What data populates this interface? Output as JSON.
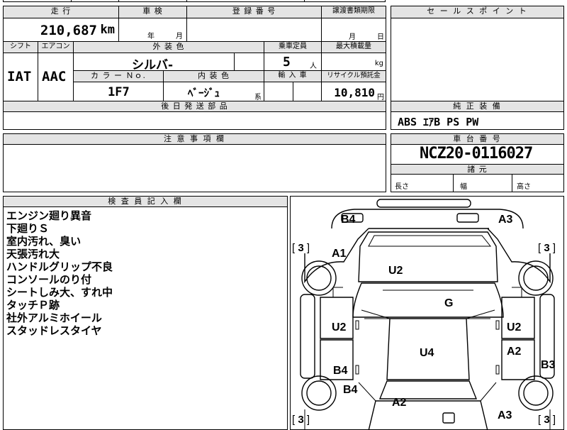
{
  "top": {
    "mileage_label": "走 行",
    "mileage_value": "210,687",
    "mileage_unit": "km",
    "inspection_label": "車 検",
    "year_unit": "年",
    "month_unit": "月",
    "reg_label": "登 録 番 号",
    "transfer_label": "譲渡書類期限",
    "transfer_month": "月",
    "transfer_day": "日"
  },
  "row2": {
    "shift_label": "シフト",
    "ac_label": "エアコン",
    "color_label": "外 装 色",
    "capacity_label": "乗車定員",
    "load_label": "最大積載量",
    "shift_value": "IAT",
    "ac_value": "AAC",
    "color_value": "シルバ-",
    "capacity_value": "5",
    "capacity_unit": "人",
    "load_unit": "kg",
    "color_no_label": "カ ラ ー Ｎｏ.",
    "interior_label": "内 装 色",
    "import_label": "輸 入 車",
    "recycle_label": "リサイクル預託金",
    "color_no_value": "1F7",
    "interior_value": "ﾍﾞｰｼﾞｭ",
    "interior_unit": "系",
    "recycle_value": "10,810",
    "recycle_unit": "円",
    "later_parts_label": "後 日 発 送 部 品"
  },
  "sales": {
    "label": "セ ー ル ス ポ イ ン ト"
  },
  "equipment": {
    "label": "純 正 装 備",
    "value": "ABS ｴｱB PS PW"
  },
  "notice": {
    "label": "注 意 事 項 欄"
  },
  "chassis": {
    "label": "車 台 番 号",
    "value": "NCZ20-0116027",
    "dims_label": "諸 元",
    "length_label": "長さ",
    "width_label": "幅",
    "height_label": "高さ"
  },
  "inspector": {
    "label": "検 査 員 記 入 欄",
    "notes": [
      "エンジン廻り異音",
      "下廻りＳ",
      "室内汚れ、臭い",
      "天張汚れ大",
      "ハンドルグリップ不良",
      "コンソールのり付",
      "シートしみ大、すれ中",
      "タッチＰ跡",
      "社外アルミホイール",
      "スタッドレスタイヤ"
    ]
  },
  "diagram": {
    "labels": {
      "b4_top_left": "B4",
      "a3_top_right": "A3",
      "a1_left": "A1",
      "u2_hood": "U2",
      "g_windshield": "G",
      "u2_left_door": "U2",
      "u2_right_door": "U2",
      "u4_roof": "U4",
      "a2_right_rear_door": "A2",
      "b4_left_rear_door": "B4",
      "b3_right": "B3",
      "b4_left_rear": "B4",
      "a2_trunk": "A2",
      "a3_bottom_right": "A3"
    },
    "wheel_grade_lf": "3",
    "wheel_grade_rf": "3",
    "wheel_grade_lr": "3",
    "wheel_grade_rr": "3"
  }
}
